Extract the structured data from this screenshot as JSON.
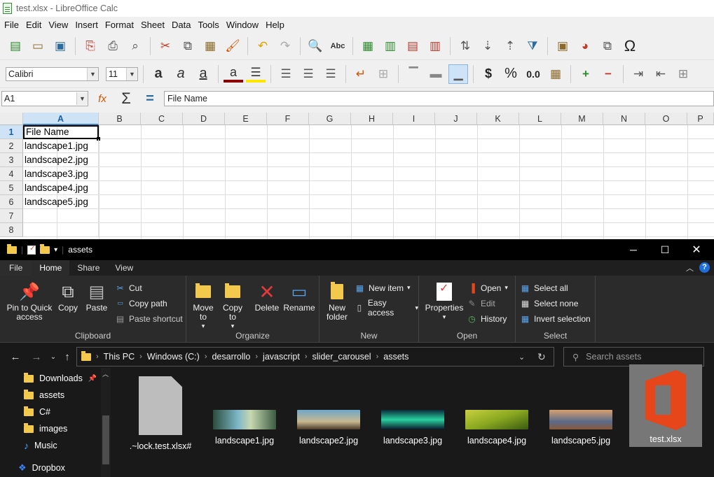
{
  "calc": {
    "title": "test.xlsx - LibreOffice Calc",
    "menu": [
      "File",
      "Edit",
      "View",
      "Insert",
      "Format",
      "Sheet",
      "Data",
      "Tools",
      "Window",
      "Help"
    ],
    "font_name": "Calibri",
    "font_size": "11",
    "cell_ref": "A1",
    "formula_value": "File Name",
    "columns": [
      "A",
      "B",
      "C",
      "D",
      "E",
      "F",
      "G",
      "H",
      "I",
      "J",
      "K",
      "L",
      "M",
      "N",
      "O",
      "P"
    ],
    "rows": [
      "1",
      "2",
      "3",
      "4",
      "5",
      "6",
      "7",
      "8"
    ],
    "cells": [
      "File Name",
      "landscape1.jpg",
      "landscape2.jpg",
      "landscape3.jpg",
      "landscape4.jpg",
      "landscape5.jpg",
      "",
      ""
    ],
    "toolbar_text": {
      "currency": "$",
      "percent": "%",
      "number": "0.0",
      "omega": "Ω"
    }
  },
  "explorer": {
    "title": "assets",
    "tabs": [
      "File",
      "Home",
      "Share",
      "View"
    ],
    "ribbon": {
      "clipboard": {
        "label": "Clipboard",
        "pin": "Pin to Quick access",
        "copy": "Copy",
        "paste": "Paste",
        "cut": "Cut",
        "copy_path": "Copy path",
        "paste_shortcut": "Paste shortcut"
      },
      "organize": {
        "label": "Organize",
        "move_to": "Move to",
        "copy_to": "Copy to",
        "delete": "Delete",
        "rename": "Rename"
      },
      "new": {
        "label": "New",
        "new_folder": "New folder",
        "new_item": "New item",
        "easy_access": "Easy access"
      },
      "open": {
        "label": "Open",
        "properties": "Properties",
        "open": "Open",
        "edit": "Edit",
        "history": "History"
      },
      "select": {
        "label": "Select",
        "select_all": "Select all",
        "select_none": "Select none",
        "invert": "Invert selection"
      }
    },
    "breadcrumb": [
      "This PC",
      "Windows (C:)",
      "desarrollo",
      "javascript",
      "slider_carousel",
      "assets"
    ],
    "search_placeholder": "Search assets",
    "nav_items": [
      "Downloads",
      "assets",
      "C#",
      "images",
      "Music",
      "Dropbox"
    ],
    "files": [
      ".~lock.test.xlsx#",
      "landscape1.jpg",
      "landscape2.jpg",
      "landscape3.jpg",
      "landscape4.jpg",
      "landscape5.jpg",
      "test.xlsx"
    ]
  }
}
